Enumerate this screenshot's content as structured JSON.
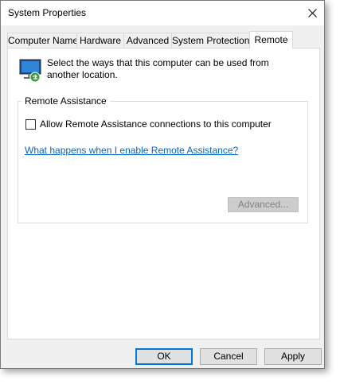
{
  "window": {
    "title": "System Properties"
  },
  "tabs": [
    {
      "label": "Computer Name",
      "active": false
    },
    {
      "label": "Hardware",
      "active": false
    },
    {
      "label": "Advanced",
      "active": false
    },
    {
      "label": "System Protection",
      "active": false
    },
    {
      "label": "Remote",
      "active": true
    }
  ],
  "remote": {
    "intro_text": "Select the ways that this computer can be used from another location.",
    "assistance_group": {
      "title": "Remote Assistance",
      "allow_checkbox_label": "Allow Remote Assistance connections to this computer",
      "allow_checked": false,
      "help_link": "What happens when I enable Remote Assistance?",
      "advanced_button": "Advanced...",
      "advanced_enabled": false
    }
  },
  "buttons": {
    "ok": "OK",
    "cancel": "Cancel",
    "apply": "Apply"
  },
  "colors": {
    "link": "#0066cc",
    "default_button_border": "#0078d7",
    "dialog_background": "#f0f0f0"
  },
  "icons": {
    "close": "close-icon",
    "computer": "remote-computer-icon"
  }
}
